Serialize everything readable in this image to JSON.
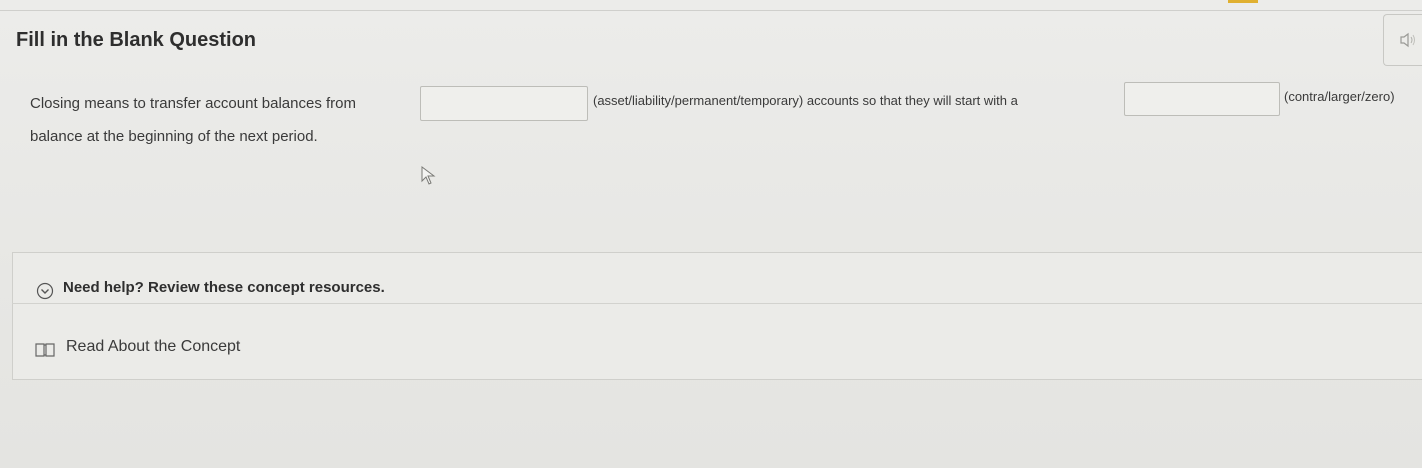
{
  "question": {
    "type_label": "Fill in the Blank Question"
  },
  "prompt": {
    "text_before_blank1": "Closing means to transfer account balances from",
    "blank1_value": "",
    "blank1_hint": "(asset/liability/permanent/temporary) accounts so that they will start with a",
    "blank2_value": "",
    "blank2_hint": "(contra/larger/zero)",
    "text_after": "balance at the beginning of the next period."
  },
  "help": {
    "toggle_label": "Need help? Review these concept resources.",
    "resources": [
      {
        "label": "Read About the Concept",
        "icon": "book-icon"
      }
    ]
  },
  "icons": {
    "audio": "speaker-icon",
    "toggle": "chevron-down-circle-icon",
    "pointer": "mouse-cursor-icon"
  },
  "colors": {
    "background": "#e9e9e6",
    "text": "#333333",
    "accent": "#e0b030",
    "border": "#bdbdb8"
  }
}
